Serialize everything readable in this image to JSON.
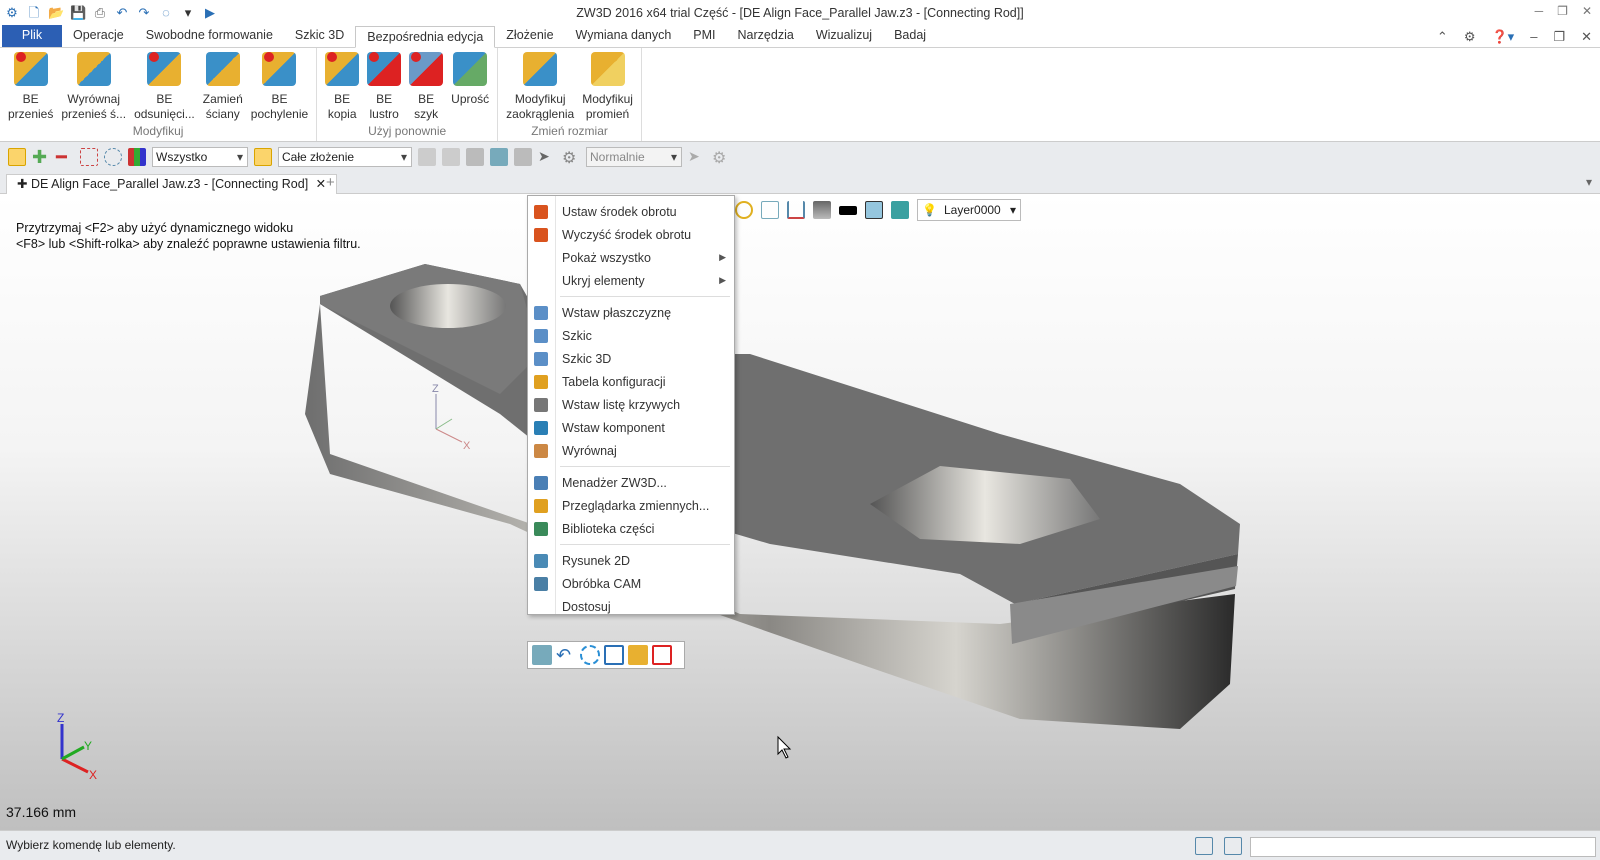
{
  "window": {
    "title": "ZW3D 2016  x64 trial        Część - [DE Align Face_Parallel Jaw.z3 - [Connecting Rod]]"
  },
  "menu": {
    "tabs": [
      "Plik",
      "Operacje",
      "Swobodne formowanie",
      "Szkic 3D",
      "Bezpośrednia edycja",
      "Złożenie",
      "Wymiana danych",
      "PMI",
      "Narzędzia",
      "Wizualizuj",
      "Badaj"
    ],
    "active": "Bezpośrednia edycja"
  },
  "ribbon": {
    "groups": [
      {
        "label": "Modyfikuj",
        "buttons": [
          "BE\nprzenieś",
          "Wyrównaj\nprzenieś ś...",
          "BE\nodsunięci...",
          "Zamień\nściany",
          "BE\npochylenie"
        ]
      },
      {
        "label": "Użyj ponownie",
        "buttons": [
          "BE\nkopia",
          "BE\nlustro",
          "BE\nszyk",
          "Uprość"
        ]
      },
      {
        "label": "Zmień rozmiar",
        "buttons": [
          "Modyfikuj\nzaokrąglenia",
          "Modyfikuj\npromień"
        ]
      }
    ]
  },
  "toolbar": {
    "filter": "Wszystko",
    "scope": "Całe złożenie",
    "mode": "Normalnie"
  },
  "doc_tab": {
    "label": "DE Align Face_Parallel Jaw.z3 - [Connecting Rod]"
  },
  "viewport": {
    "hint1": "Przytrzymaj <F2> aby użyć dynamicznego widoku",
    "hint2": "<F8> lub <Shift-rolka> aby znaleźć poprawne ustawienia filtru.",
    "scale": "37.166 mm",
    "layer": "Layer0000",
    "axes": {
      "x": "X",
      "y": "Y",
      "z": "Z"
    }
  },
  "context_menu": {
    "sections": [
      [
        {
          "label": "Ustaw środek obrotu",
          "color": "#d9531e"
        },
        {
          "label": "Wyczyść środek obrotu",
          "color": "#d9531e"
        },
        {
          "label": "Pokaż wszystko",
          "submenu": true
        },
        {
          "label": "Ukryj elementy",
          "submenu": true
        }
      ],
      [
        {
          "label": "Wstaw płaszczyznę",
          "color": "#5b8fc7"
        },
        {
          "label": "Szkic",
          "color": "#5b8fc7"
        },
        {
          "label": "Szkic 3D",
          "color": "#5b8fc7"
        },
        {
          "label": "Tabela konfiguracji",
          "color": "#e0a020"
        },
        {
          "label": "Wstaw listę krzywych",
          "color": "#777"
        },
        {
          "label": "Wstaw komponent",
          "color": "#2a7fb5"
        },
        {
          "label": "Wyrównaj",
          "color": "#c84"
        }
      ],
      [
        {
          "label": "Menadżer ZW3D...",
          "color": "#4a7fb5"
        },
        {
          "label": "Przeglądarka zmiennych...",
          "color": "#e0a020"
        },
        {
          "label": "Biblioteka części",
          "color": "#3a8a5a"
        }
      ],
      [
        {
          "label": "Rysunek 2D",
          "color": "#4a8ab5"
        },
        {
          "label": "Obróbka CAM",
          "color": "#4a7fa5"
        },
        {
          "label": "Dostosuj"
        }
      ]
    ]
  },
  "status": {
    "text": "Wybierz komendę lub elementy."
  }
}
